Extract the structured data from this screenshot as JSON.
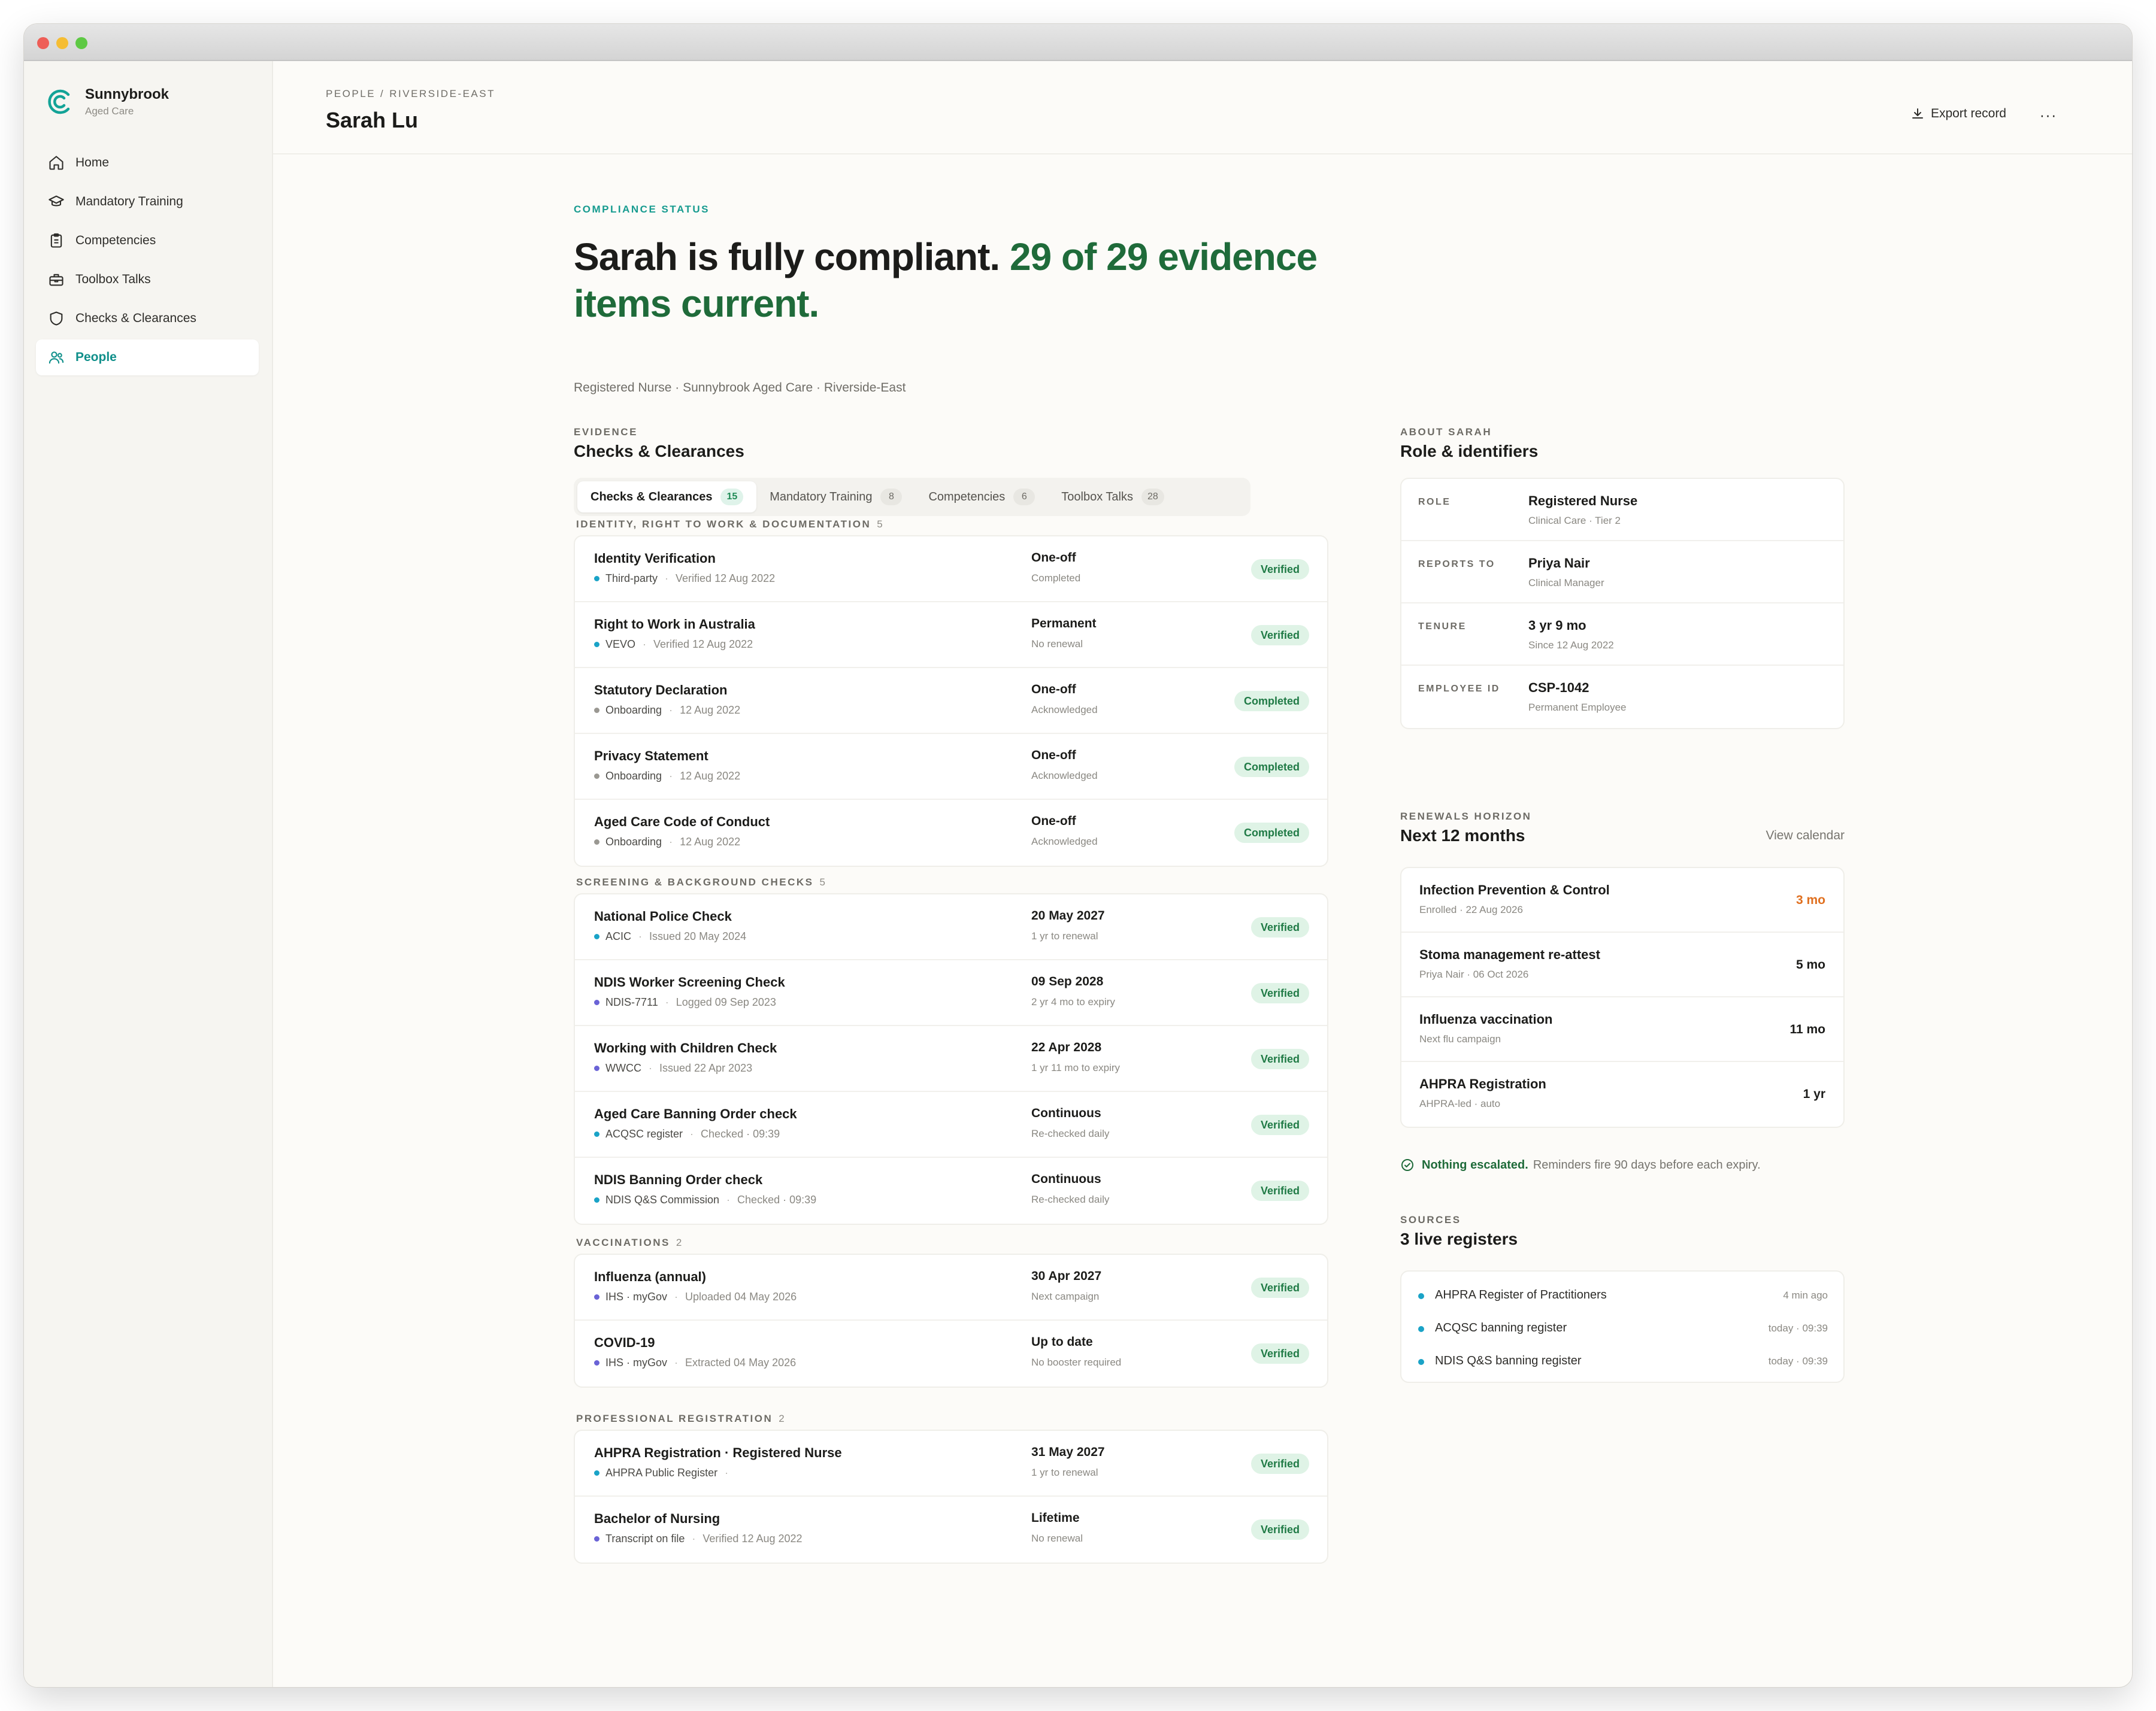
{
  "brand": {
    "name": "Sunnybrook",
    "sub": "Aged Care",
    "accent": "#0f8f8a"
  },
  "nav": [
    {
      "label": "Home",
      "icon": "home-icon",
      "active": false
    },
    {
      "label": "Mandatory Training",
      "icon": "graduation-cap-icon",
      "active": false
    },
    {
      "label": "Competencies",
      "icon": "clipboard-icon",
      "active": false
    },
    {
      "label": "Toolbox Talks",
      "icon": "toolbox-icon",
      "active": false
    },
    {
      "label": "Checks & Clearances",
      "icon": "shield-icon",
      "active": false
    },
    {
      "label": "People",
      "icon": "users-icon",
      "active": true
    }
  ],
  "header": {
    "breadcrumb": [
      "PEOPLE",
      "RIVERSIDE-EAST"
    ],
    "breadcrumb_sep": "/",
    "person": "Sarah Lu",
    "export_label": "Export record",
    "more_label": "···"
  },
  "hero": {
    "eyebrow": "COMPLIANCE STATUS",
    "headline_main": "Sarah is fully compliant.",
    "headline_highlight": "29 of 29 evidence items current.",
    "subtitle": "Registered Nurse · Sunnybrook Aged Care · Riverside-East",
    "highlight_color": "#1f6b3a"
  },
  "evidence": {
    "eyebrow": "EVIDENCE",
    "title": "Checks & Clearances",
    "tabs": [
      {
        "label": "Checks & Clearances",
        "count": "15",
        "active": true
      },
      {
        "label": "Mandatory Training",
        "count": "8",
        "active": false
      },
      {
        "label": "Competencies",
        "count": "6",
        "active": false
      },
      {
        "label": "Toolbox Talks",
        "count": "28",
        "active": false
      }
    ],
    "groups": [
      {
        "title": "IDENTITY, RIGHT TO WORK & DOCUMENTATION",
        "count": "5",
        "rows": [
          {
            "title": "Identity Verification",
            "source": "Third-party",
            "detail": "Verified 12 Aug 2022",
            "when": "One-off",
            "when_sub": "Completed",
            "status": "Verified",
            "dot": "#1aa3c7"
          },
          {
            "title": "Right to Work in Australia",
            "source": "VEVO",
            "detail": "Verified 12 Aug 2022",
            "when": "Permanent",
            "when_sub": "No renewal",
            "status": "Verified",
            "dot": "#1aa3c7"
          },
          {
            "title": "Statutory Declaration",
            "source": "Onboarding",
            "detail": "12 Aug 2022",
            "when": "One-off",
            "when_sub": "Acknowledged",
            "status": "Completed",
            "dot": "#9a9892"
          },
          {
            "title": "Privacy Statement",
            "source": "Onboarding",
            "detail": "12 Aug 2022",
            "when": "One-off",
            "when_sub": "Acknowledged",
            "status": "Completed",
            "dot": "#9a9892"
          },
          {
            "title": "Aged Care Code of Conduct",
            "source": "Onboarding",
            "detail": "12 Aug 2022",
            "when": "One-off",
            "when_sub": "Acknowledged",
            "status": "Completed",
            "dot": "#9a9892"
          }
        ]
      },
      {
        "title": "SCREENING & BACKGROUND CHECKS",
        "count": "5",
        "rows": [
          {
            "title": "National Police Check",
            "source": "ACIC",
            "detail": "Issued 20 May 2024",
            "when": "20 May 2027",
            "when_sub": "1 yr to renewal",
            "status": "Verified",
            "dot": "#1aa3c7"
          },
          {
            "title": "NDIS Worker Screening Check",
            "source": "NDIS-7711",
            "detail": "Logged 09 Sep 2023",
            "when": "09 Sep 2028",
            "when_sub": "2 yr 4 mo to expiry",
            "status": "Verified",
            "dot": "#6a63d6"
          },
          {
            "title": "Working with Children Check",
            "source": "WWCC",
            "detail": "Issued 22 Apr 2023",
            "when": "22 Apr 2028",
            "when_sub": "1 yr 11 mo to expiry",
            "status": "Verified",
            "dot": "#6a63d6"
          },
          {
            "title": "Aged Care Banning Order check",
            "source": "ACQSC register",
            "detail": "Checked · 09:39",
            "when": "Continuous",
            "when_sub": "Re-checked daily",
            "status": "Verified",
            "dot": "#1aa3c7"
          },
          {
            "title": "NDIS Banning Order check",
            "source": "NDIS Q&S Commission",
            "detail": "Checked · 09:39",
            "when": "Continuous",
            "when_sub": "Re-checked daily",
            "status": "Verified",
            "dot": "#1aa3c7"
          }
        ]
      },
      {
        "title": "VACCINATIONS",
        "count": "2",
        "rows": [
          {
            "title": "Influenza (annual)",
            "source": "IHS · myGov",
            "detail": "Uploaded 04 May 2026",
            "when": "30 Apr 2027",
            "when_sub": "Next campaign",
            "status": "Verified",
            "dot": "#6a63d6"
          },
          {
            "title": "COVID-19",
            "source": "IHS · myGov",
            "detail": "Extracted 04 May 2026",
            "when": "Up to date",
            "when_sub": "No booster required",
            "status": "Verified",
            "dot": "#6a63d6"
          }
        ]
      },
      {
        "title": "PROFESSIONAL REGISTRATION",
        "count": "2",
        "rows": [
          {
            "title": "AHPRA Registration · Registered Nurse",
            "source": "AHPRA Public Register",
            "detail": "",
            "when": "31 May 2027",
            "when_sub": "1 yr to renewal",
            "status": "Verified",
            "dot": "#1aa3c7"
          },
          {
            "title": "Bachelor of Nursing",
            "source": "Transcript on file",
            "detail": "Verified 12 Aug 2022",
            "when": "Lifetime",
            "when_sub": "No renewal",
            "status": "Verified",
            "dot": "#6a63d6"
          }
        ]
      }
    ]
  },
  "about": {
    "eyebrow": "ABOUT SARAH",
    "title": "Role & identifiers",
    "rows": [
      {
        "label": "ROLE",
        "value": "Registered Nurse",
        "sub": "Clinical Care · Tier 2"
      },
      {
        "label": "REPORTS TO",
        "value": "Priya Nair",
        "sub": "Clinical Manager"
      },
      {
        "label": "TENURE",
        "value": "3 yr 9 mo",
        "sub": "Since 12 Aug 2022"
      },
      {
        "label": "EMPLOYEE ID",
        "value": "CSP-1042",
        "sub": "Permanent Employee"
      }
    ]
  },
  "renewals": {
    "eyebrow": "RENEWALS HORIZON",
    "title": "Next 12 months",
    "link": "View calendar",
    "rows": [
      {
        "title": "Infection Prevention & Control",
        "sub": "Enrolled · 22 Aug 2026",
        "time": "3 mo",
        "warn": true
      },
      {
        "title": "Stoma management re-attest",
        "sub": "Priya Nair · 06 Oct 2026",
        "time": "5 mo",
        "warn": false
      },
      {
        "title": "Influenza vaccination",
        "sub": "Next flu campaign",
        "time": "11 mo",
        "warn": false
      },
      {
        "title": "AHPRA Registration",
        "sub": "AHPRA-led · auto",
        "time": "1 yr",
        "warn": false
      }
    ],
    "escalation_strong": "Nothing escalated.",
    "escalation_rest": "Reminders fire 90 days before each expiry.",
    "warn_color": "#e07020"
  },
  "sources": {
    "eyebrow": "SOURCES",
    "title": "3 live registers",
    "rows": [
      {
        "name": "AHPRA Register of Practitioners",
        "time": "4 min ago"
      },
      {
        "name": "ACQSC banning register",
        "time": "today · 09:39"
      },
      {
        "name": "NDIS Q&S banning register",
        "time": "today · 09:39"
      }
    ]
  }
}
